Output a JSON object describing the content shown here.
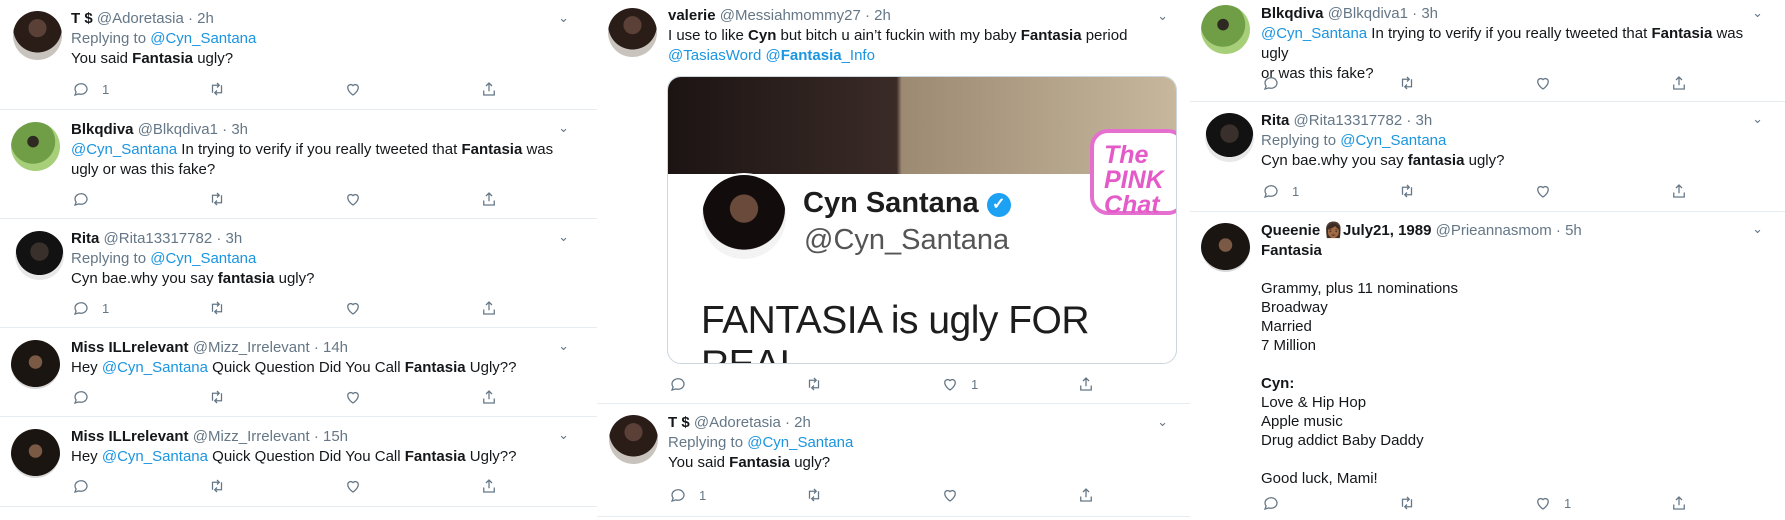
{
  "columns": [
    {
      "tweets": [
        {
          "name": "T $",
          "handle": "@Adoretasia",
          "time": "2h",
          "replying_prefix": "Replying to",
          "replying_to": "@Cyn_Santana",
          "text_parts": [
            "You said ",
            "Fantasia",
            " ugly?"
          ],
          "counts": {
            "reply": "1",
            "retweet": "",
            "like": ""
          }
        },
        {
          "name": "Blkqdiva",
          "handle": "@Blkqdiva1",
          "time": "3h",
          "mention": "@Cyn_Santana",
          "text_parts": [
            " In trying to verify if you really tweeted that ",
            "Fantasia",
            " was"
          ],
          "text_line2": "ugly or was this fake?",
          "counts": {
            "reply": "",
            "retweet": "",
            "like": ""
          }
        },
        {
          "name": "Rita",
          "handle": "@Rita13317782",
          "time": "3h",
          "replying_prefix": "Replying to",
          "replying_to": "@Cyn_Santana",
          "text_parts": [
            "Cyn bae.why you say ",
            "fantasia",
            " ugly?"
          ],
          "counts": {
            "reply": "1",
            "retweet": "",
            "like": ""
          }
        },
        {
          "name": "Miss ILLrelevant",
          "handle": "@Mizz_Irrelevant",
          "time": "14h",
          "prefix": "Hey ",
          "mention": "@Cyn_Santana",
          "text_parts": [
            "  Quick Question Did You Call ",
            "Fantasia",
            " Ugly??"
          ],
          "counts": {
            "reply": "",
            "retweet": "",
            "like": ""
          }
        },
        {
          "name": "Miss ILLrelevant",
          "handle": "@Mizz_Irrelevant",
          "time": "15h",
          "prefix": "Hey ",
          "mention": "@Cyn_Santana",
          "text_parts": [
            "  Quick Question Did You Call ",
            "Fantasia",
            " Ugly??"
          ],
          "counts": {
            "reply": "",
            "retweet": "",
            "like": ""
          }
        }
      ]
    },
    {
      "tweets": [
        {
          "name": "valerie",
          "handle": "@Messiahmommy27",
          "time": "2h",
          "text_parts": [
            "I use to like ",
            "Cyn",
            " but bitch u ain’t fuckin with my baby ",
            "Fantasia",
            " period"
          ],
          "mention_a": "@TasiasWord",
          "mention_b_prefix": "@",
          "mention_b_bold": "Fantasia",
          "mention_b_suffix": "_Info",
          "media": {
            "card_name": "Cyn Santana",
            "card_handle": "@Cyn_Santana",
            "card_text": "FANTASIA is ugly FOR REAL",
            "sticker_line1": "The",
            "sticker_line2": "PINK",
            "sticker_line3": "Chat"
          },
          "counts": {
            "reply": "",
            "retweet": "",
            "like": "1"
          }
        },
        {
          "name": "T $",
          "handle": "@Adoretasia",
          "time": "2h",
          "replying_prefix": "Replying to",
          "replying_to": "@Cyn_Santana",
          "text_parts": [
            "You said ",
            "Fantasia",
            " ugly?"
          ],
          "counts": {
            "reply": "1",
            "retweet": "",
            "like": ""
          }
        }
      ]
    },
    {
      "tweets": [
        {
          "name": "Blkqdiva",
          "handle": "@Blkqdiva1",
          "time": "3h",
          "mention": "@Cyn_Santana",
          "text_parts": [
            " In trying to verify if you really tweeted that ",
            "Fantasia",
            " was ugly"
          ],
          "text_line2": "or was this fake?",
          "counts": {
            "reply": "",
            "retweet": "",
            "like": ""
          }
        },
        {
          "name": "Rita",
          "handle": "@Rita13317782",
          "time": "3h",
          "replying_prefix": "Replying to",
          "replying_to": "@Cyn_Santana",
          "text_parts": [
            "Cyn bae.why you say ",
            "fantasia",
            " ugly?"
          ],
          "counts": {
            "reply": "1",
            "retweet": "",
            "like": ""
          }
        },
        {
          "name": "Queenie 👩🏾July21, 1989",
          "handle": "@Prieannasmom",
          "time": "5h",
          "lines": [
            "Fantasia",
            "",
            "Grammy, plus 11 nominations",
            "Broadway",
            "Married",
            "7 Million",
            "",
            "Cyn:",
            "Love & Hip Hop",
            "Apple music",
            "Drug addict Baby Daddy",
            "",
            "Good luck, Mami!"
          ],
          "counts": {
            "reply": "",
            "retweet": "",
            "like": "1"
          }
        }
      ]
    }
  ],
  "icons": {
    "reply": "reply-icon",
    "retweet": "retweet-icon",
    "like": "like-icon",
    "share": "share-icon",
    "more": "chevron-down-icon"
  },
  "colors": {
    "link": "#1b95e0",
    "muted": "#657786",
    "border": "#e6ecf0",
    "pink": "#e35ac8",
    "verified": "#1da1f2"
  },
  "separators": {
    "handle_time": "·"
  }
}
